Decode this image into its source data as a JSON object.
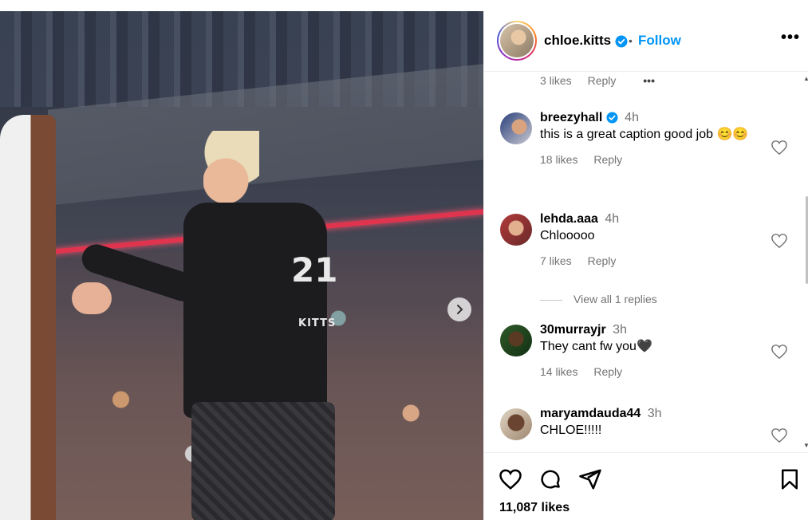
{
  "post": {
    "username": "chloe.kitts",
    "separator": "•",
    "follow_label": "Follow",
    "more_icon": "more-options-icon",
    "more_glyph": "•••",
    "likes_total": "11,087 likes"
  },
  "photo": {
    "jersey_number": "21",
    "jersey_name": "KITTS"
  },
  "top_meta": {
    "likes": "3 likes",
    "reply": "Reply",
    "more": "•••"
  },
  "comments": [
    {
      "user": "breezyhall",
      "verified": true,
      "time": "4h",
      "text": "this is a great caption good job 😊😊",
      "likes": "18 likes",
      "reply": "Reply"
    },
    {
      "user": "lehda.aaa",
      "verified": false,
      "time": "4h",
      "text": "Chlooooo",
      "likes": "7 likes",
      "reply": "Reply"
    },
    {
      "user": "30murrayjr",
      "verified": false,
      "time": "3h",
      "text": "They cant fw you🖤",
      "likes": "14 likes",
      "reply": "Reply"
    },
    {
      "user": "maryamdauda44",
      "verified": false,
      "time": "3h",
      "text": "CHLOE!!!!!"
    }
  ],
  "view_replies": "View all 1 replies",
  "colors": {
    "accent": "#0095f6",
    "muted": "#737373",
    "verified": "#0095f6"
  }
}
